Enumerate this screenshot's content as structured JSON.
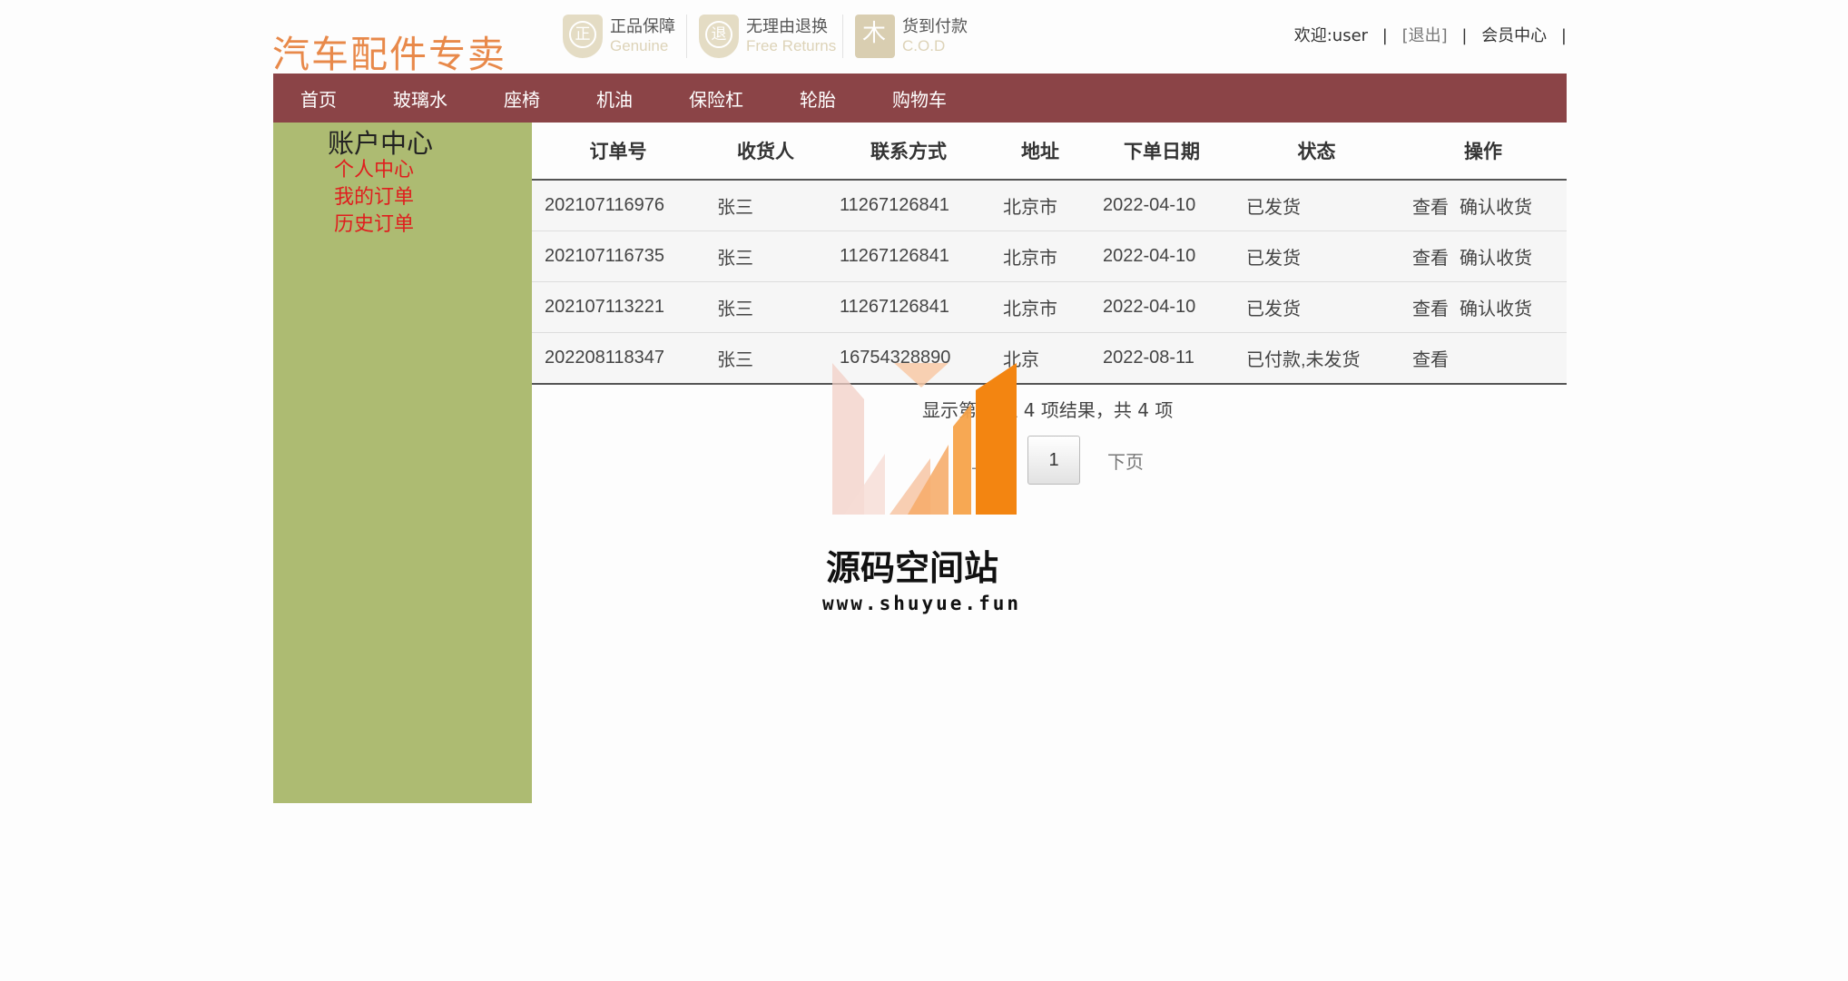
{
  "header": {
    "logo": "汽车配件专卖",
    "badges": [
      {
        "icon": "正",
        "title": "正品保障",
        "subtitle": "Genuine"
      },
      {
        "icon": "退",
        "title": "无理由退换",
        "subtitle": "Free Returns"
      },
      {
        "icon": "木",
        "title": "货到付款",
        "subtitle": "C.O.D"
      }
    ],
    "user": {
      "welcome": "欢迎:user",
      "logout": "[退出]",
      "member_center": "会员中心",
      "separator": "|"
    }
  },
  "nav": {
    "items": [
      "首页",
      "玻璃水",
      "座椅",
      "机油",
      "保险杠",
      "轮胎",
      "购物车"
    ],
    "color": "#8b4447"
  },
  "sidebar": {
    "title": "账户中心",
    "links": [
      "个人中心",
      "我的订单",
      "历史订单"
    ],
    "background": "#adbb72",
    "link_color": "#e01e1e"
  },
  "orders": {
    "columns": [
      "订单号",
      "收货人",
      "联系方式",
      "地址",
      "下单日期",
      "状态",
      "操作"
    ],
    "rows": [
      {
        "id": "202107116976",
        "receiver": "张三",
        "phone": "11267126841",
        "address": "北京市",
        "date": "2022-04-10",
        "status": "已发货",
        "actions": [
          "查看",
          "确认收货"
        ]
      },
      {
        "id": "202107116735",
        "receiver": "张三",
        "phone": "11267126841",
        "address": "北京市",
        "date": "2022-04-10",
        "status": "已发货",
        "actions": [
          "查看",
          "确认收货"
        ]
      },
      {
        "id": "202107113221",
        "receiver": "张三",
        "phone": "11267126841",
        "address": "北京市",
        "date": "2022-04-10",
        "status": "已发货",
        "actions": [
          "查看",
          "确认收货"
        ]
      },
      {
        "id": "202208118347",
        "receiver": "张三",
        "phone": "16754328890",
        "address": "北京",
        "date": "2022-08-11",
        "status": "已付款,未发货",
        "actions": [
          "查看"
        ]
      }
    ]
  },
  "pagination": {
    "info": "显示第 1 至 4 项结果，共 4 项",
    "prev": "上页",
    "current": "1",
    "next": "下页"
  },
  "watermark": {
    "title": "源码空间站",
    "url": "www.shuyue.fun"
  }
}
